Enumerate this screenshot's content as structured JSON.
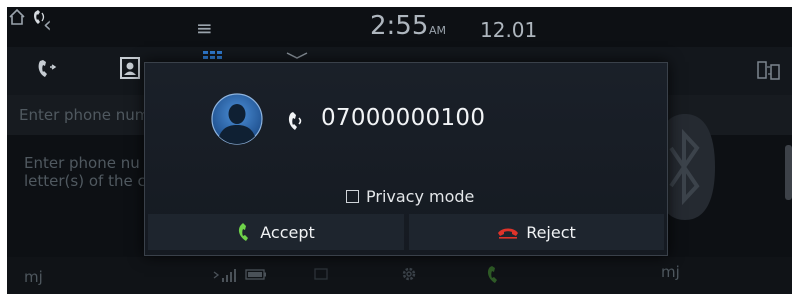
{
  "status_bar": {
    "time": "2:55",
    "ampm": "AM",
    "date": "12.01"
  },
  "background": {
    "search_placeholder": "Enter phone num",
    "hint_line1": "Enter phone nu",
    "hint_line2": "letter(s) of the c",
    "user_left": "mj",
    "user_right": "mj"
  },
  "dialog": {
    "phone_number": "07000000100",
    "privacy_label": "Privacy mode",
    "privacy_checked": false,
    "accept_label": "Accept",
    "reject_label": "Reject"
  },
  "colors": {
    "accept_green": "#6fd34a",
    "reject_red": "#e0332a",
    "modal_bg": "#171c24"
  },
  "icons": {
    "back": "back-icon",
    "home": "home-icon",
    "menu": "menu-icon",
    "call_status": "call-status-icon",
    "bluetooth": "bluetooth-icon",
    "avatar": "avatar-icon",
    "incoming_call": "call-icon",
    "accept": "phone-accept-icon",
    "reject": "phone-reject-icon"
  }
}
